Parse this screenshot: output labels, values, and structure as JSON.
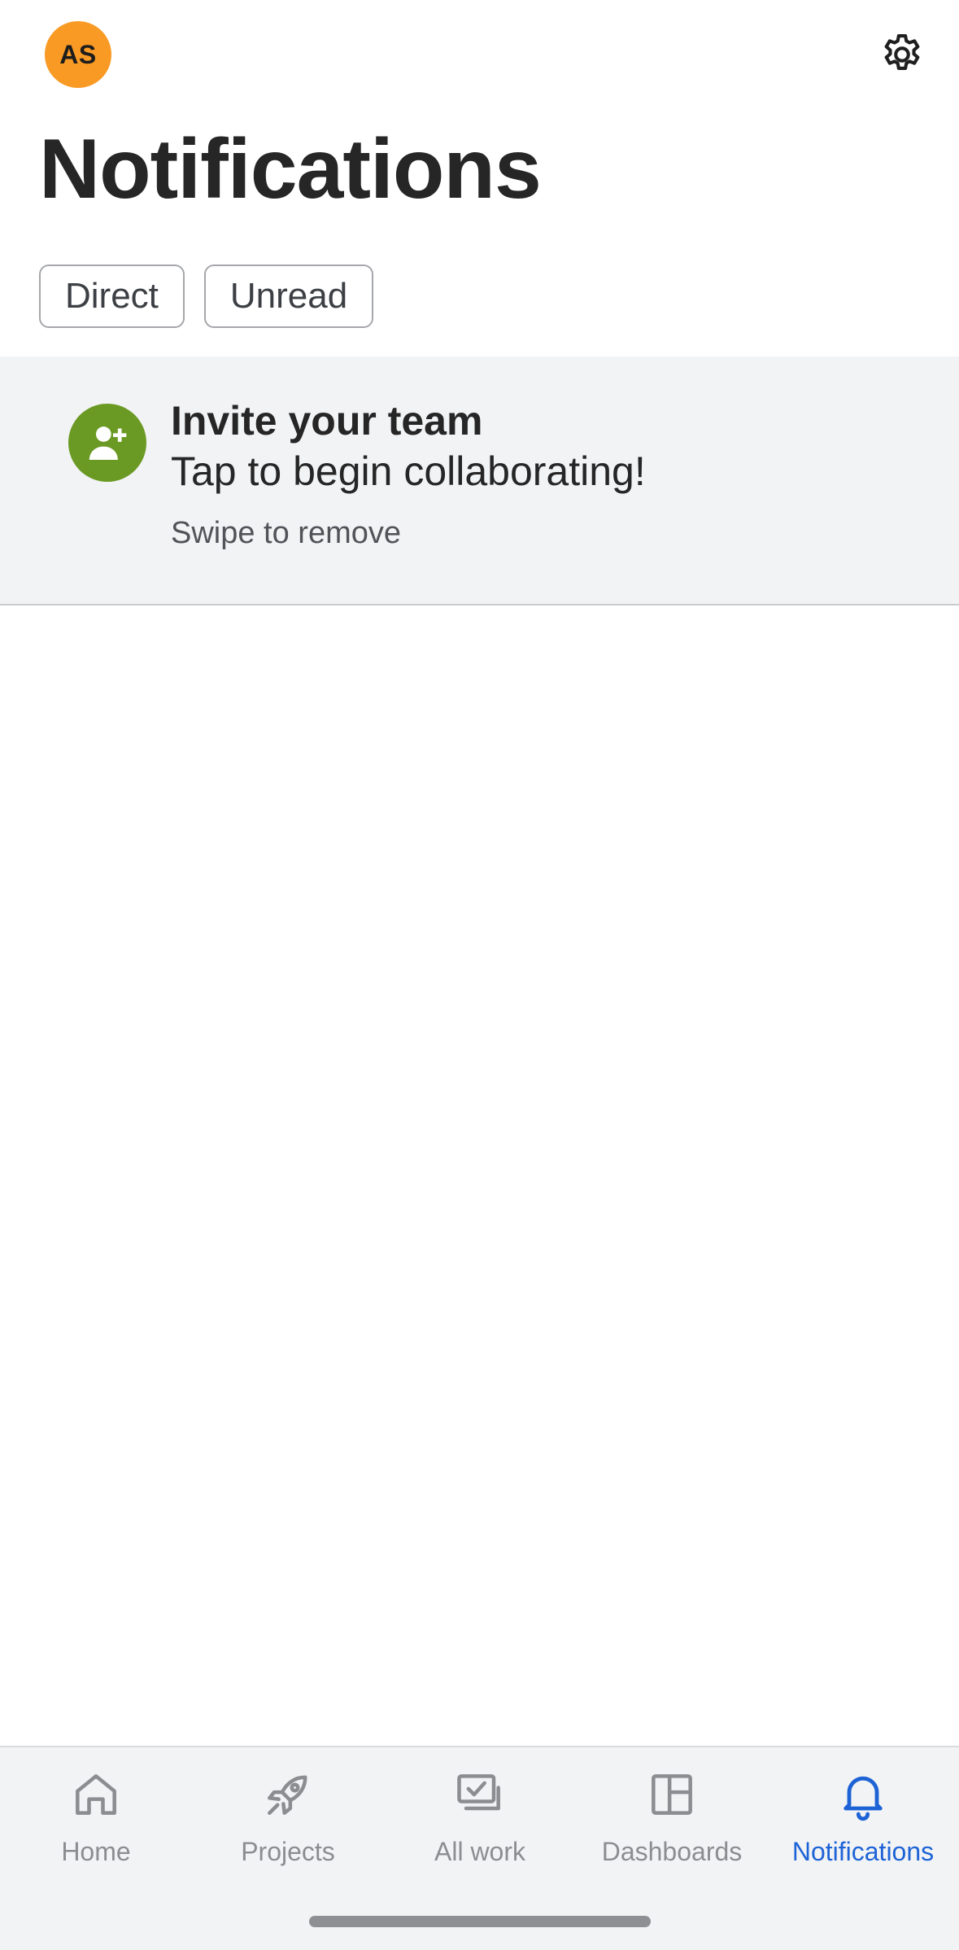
{
  "header": {
    "avatar_initials": "AS",
    "avatar_color": "#f99a24",
    "settings_icon": "gear-icon",
    "title": "Notifications"
  },
  "filters": [
    {
      "label": "Direct"
    },
    {
      "label": "Unread"
    }
  ],
  "invite_card": {
    "icon": "add-user-icon",
    "icon_color": "#6a9a23",
    "title": "Invite your team",
    "subtitle": "Tap to begin collaborating!",
    "hint": "Swipe to remove"
  },
  "bottom_nav": {
    "active_color": "#1d63d6",
    "items": [
      {
        "label": "Home",
        "icon": "home-icon"
      },
      {
        "label": "Projects",
        "icon": "rocket-icon"
      },
      {
        "label": "All work",
        "icon": "all-work-icon"
      },
      {
        "label": "Dashboards",
        "icon": "dashboard-icon"
      },
      {
        "label": "Notifications",
        "icon": "bell-icon",
        "active": true
      }
    ]
  }
}
